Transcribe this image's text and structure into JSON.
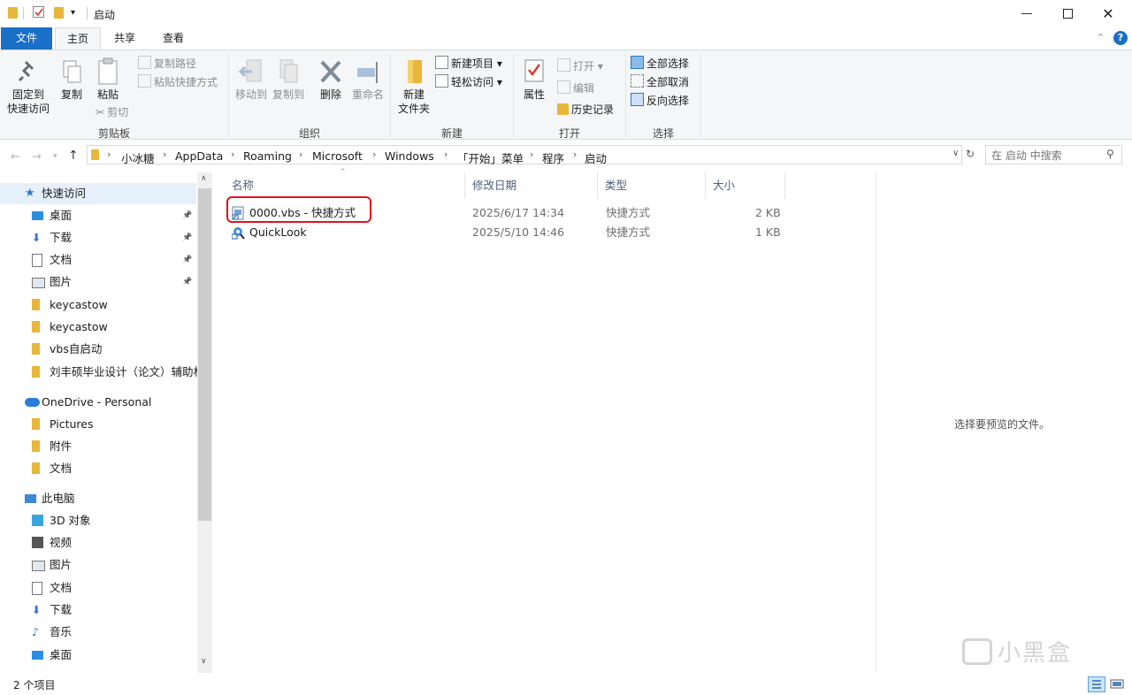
{
  "window": {
    "title": "启动",
    "minimize_icon": "minimize-icon",
    "maximize_icon": "maximize-icon",
    "close_icon": "close-icon"
  },
  "tabs": [
    {
      "label": "文件"
    },
    {
      "label": "主页"
    },
    {
      "label": "共享"
    },
    {
      "label": "查看"
    }
  ],
  "ribbon": {
    "clipboard": {
      "label": "剪贴板",
      "pin_label_1": "固定到",
      "pin_label_2": "快速访问",
      "copy": "复制",
      "paste": "粘贴",
      "copy_path": "复制路径",
      "paste_shortcut": "粘贴快捷方式",
      "cut": "剪切"
    },
    "organize": {
      "label": "组织",
      "move_to": "移动到",
      "copy_to": "复制到",
      "delete": "删除",
      "rename": "重命名"
    },
    "new": {
      "label": "新建",
      "new_folder_1": "新建",
      "new_folder_2": "文件夹",
      "new_item": "新建项目",
      "easy_access": "轻松访问"
    },
    "open": {
      "label": "打开",
      "properties": "属性",
      "open": "打开",
      "edit": "编辑",
      "history": "历史记录"
    },
    "select": {
      "label": "选择",
      "select_all": "全部选择",
      "select_none": "全部取消",
      "invert": "反向选择"
    }
  },
  "address": {
    "crumbs": [
      "小冰糖",
      "AppData",
      "Roaming",
      "Microsoft",
      "Windows",
      "「开始」菜单",
      "程序",
      "启动"
    ],
    "search_placeholder": "在 启动 中搜索"
  },
  "sidebar": {
    "items": [
      {
        "label": "快速访问",
        "icon": "star-icon",
        "pinned": false
      },
      {
        "label": "桌面",
        "icon": "desktop-icon",
        "pinned": true
      },
      {
        "label": "下载",
        "icon": "download-icon",
        "pinned": true
      },
      {
        "label": "文档",
        "icon": "document-icon",
        "pinned": true
      },
      {
        "label": "图片",
        "icon": "pictures-icon",
        "pinned": true
      },
      {
        "label": "keycastow",
        "icon": "folder-icon",
        "pinned": false
      },
      {
        "label": "keycastow",
        "icon": "folder-icon",
        "pinned": false
      },
      {
        "label": "vbs自启动",
        "icon": "folder-icon",
        "pinned": false
      },
      {
        "label": "刘丰硕毕业设计（论文）辅助材",
        "icon": "folder-icon",
        "pinned": false
      },
      {
        "label": "OneDrive - Personal",
        "icon": "cloud-icon",
        "pinned": false
      },
      {
        "label": "Pictures",
        "icon": "folder-icon",
        "pinned": false
      },
      {
        "label": "附件",
        "icon": "folder-icon",
        "pinned": false
      },
      {
        "label": "文档",
        "icon": "folder-icon",
        "pinned": false
      },
      {
        "label": "此电脑",
        "icon": "computer-icon",
        "pinned": false
      },
      {
        "label": "3D 对象",
        "icon": "3d-objects-icon",
        "pinned": false
      },
      {
        "label": "视频",
        "icon": "video-icon",
        "pinned": false
      },
      {
        "label": "图片",
        "icon": "pictures-icon",
        "pinned": false
      },
      {
        "label": "文档",
        "icon": "document-icon",
        "pinned": false
      },
      {
        "label": "下载",
        "icon": "download-icon",
        "pinned": false
      },
      {
        "label": "音乐",
        "icon": "music-icon",
        "pinned": false
      },
      {
        "label": "桌面",
        "icon": "desktop-icon",
        "pinned": false
      }
    ]
  },
  "files": {
    "columns": [
      "名称",
      "修改日期",
      "类型",
      "大小"
    ],
    "rows": [
      {
        "name": "0000.vbs - 快捷方式",
        "date": "2025/6/17 14:34",
        "type": "快捷方式",
        "size": "2 KB",
        "icon": "vbs-shortcut-icon"
      },
      {
        "name": "QuickLook",
        "date": "2025/5/10 14:46",
        "type": "快捷方式",
        "size": "1 KB",
        "icon": "quicklook-icon"
      }
    ]
  },
  "preview": {
    "text": "选择要预览的文件。"
  },
  "status": {
    "count": "2 个项目"
  },
  "watermark": {
    "text": "小黑盒"
  },
  "colors": {
    "accent": "#1a6fc7",
    "highlight": "#e0141e",
    "folder": "#e8b73a"
  }
}
